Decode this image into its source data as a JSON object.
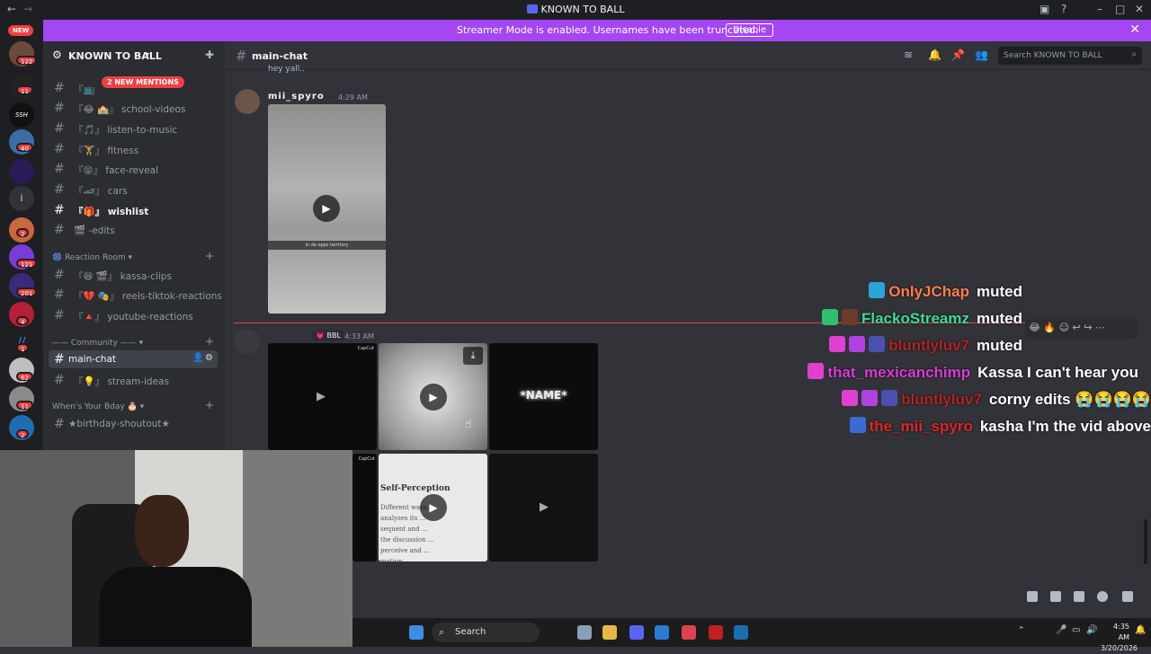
{
  "window": {
    "title": "KNOWN TO BALL"
  },
  "banner": {
    "text": "Streamer Mode is enabled. Usernames have been truncated.",
    "button": "Disable"
  },
  "servers": {
    "new_label": "NEW",
    "badges": [
      "122",
      "11",
      "40",
      "2",
      "121",
      "201",
      "4",
      "1",
      "62",
      "11",
      "2"
    ],
    "ssh": "SSH",
    "info": "i"
  },
  "sidebar": {
    "server_name": "KNOWN TO BALL",
    "mentions_pill": "2 NEW MENTIONS",
    "channels_top": [
      {
        "label": "school-videos"
      },
      {
        "label": "listen-to-music"
      },
      {
        "label": "fitness"
      },
      {
        "label": "face-reveal"
      },
      {
        "label": "cars"
      },
      {
        "label": "wishlist"
      },
      {
        "label": "-edits"
      }
    ],
    "category_reaction": "Reaction Room",
    "channels_reaction": [
      {
        "label": "kassa-clips"
      },
      {
        "label": "reels-tiktok-reactions"
      },
      {
        "label": "youtube-reactions"
      }
    ],
    "category_community": "—— Community ——",
    "channels_community": [
      {
        "label": "main-chat"
      },
      {
        "label": "stream-ideas"
      }
    ],
    "category_bday": "When's Your Bday 🎂",
    "channels_bday": [
      {
        "label": "★birthday-shoutout★"
      }
    ]
  },
  "chat": {
    "channel": "main-chat",
    "search_placeholder": "Search KNOWN TO BALL",
    "prev_line": "hey yall..",
    "msg1": {
      "author": "mii_spyro",
      "time": "4:29 AM",
      "caption": "in da opps territory"
    },
    "msg2": {
      "badge": "BBL",
      "time": "4:33 AM",
      "capcut": "CapCut",
      "name_text": "*NAME*",
      "self_perception": "Self-Perception",
      "body": "Different ways... analyzes its ... sequent and ... the discussion ... perceive and ... mation ..."
    }
  },
  "overlay": {
    "rows": [
      {
        "user": "OnlyJChap",
        "msg": "muted",
        "color": "#ff7f50"
      },
      {
        "user": "FlackoStreamz",
        "msg": "muted",
        "color": "#3ddc97"
      },
      {
        "user": "bluntlyluv7",
        "msg": "muted",
        "color": "#b22222"
      },
      {
        "user": "that_mexicanchimp",
        "msg": "Kassa I can't hear you",
        "color": "#da3bd6"
      },
      {
        "user": "bluntlyluv7",
        "msg": "corny edits 😭😭😭😭",
        "color": "#b22222"
      },
      {
        "user": "the_mii_spyro",
        "msg": "kasha I'm the vid above",
        "color": "#e02626"
      }
    ]
  },
  "taskbar": {
    "search": "Search",
    "time": "4:35 AM",
    "date": "3/20/2026"
  },
  "colors": {
    "blurple": "#5865f2",
    "streamer_banner": "#a447f3",
    "mention_red": "#f23f43"
  }
}
